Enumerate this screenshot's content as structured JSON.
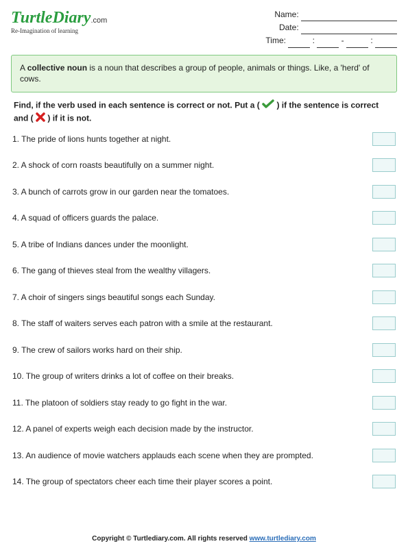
{
  "logo": {
    "main": "TurtleDiary",
    "dotcom": ".com",
    "tagline": "Re-Imagination of learning"
  },
  "info": {
    "name_label": "Name:",
    "date_label": "Date:",
    "time_label": "Time:"
  },
  "definition": {
    "before": "A ",
    "term": "collective noun",
    "after": " is a noun that describes a group of people, animals or things. Like, a 'herd' of cows."
  },
  "instructions": {
    "part1": "Find, if the verb used in each sentence is correct or not. Put a (",
    "part2": ") if the sentence is correct and (",
    "part3": ") if it is not."
  },
  "questions": [
    "1. The pride of lions hunts together at night.",
    "2. A shock of corn roasts beautifully on a summer night.",
    "3. A bunch of carrots  grow in our garden near the tomatoes.",
    "4. A squad of officers guards the palace.",
    "5. A tribe of Indians dances under the moonlight.",
    "6. The gang of thieves steal from the wealthy villagers.",
    "7. A choir of singers sings beautiful songs each Sunday.",
    "8. The staff of waiters serves  each patron with a smile at the restaurant.",
    "9. The crew of sailors works hard on their ship.",
    "10. The group of writers  drinks a lot of coffee on their breaks.",
    "11. The platoon of soldiers stay ready to go fight in the war.",
    "12. A panel of experts weigh each decision made by the instructor.",
    "13.  An audience of movie watchers applauds each scene when they are prompted.",
    "14.  The group of spectators cheer each time their player scores a point."
  ],
  "footer": {
    "copyright": "Copyright © Turtlediary.com. All rights reserved ",
    "link": "www.turtlediary.com"
  }
}
